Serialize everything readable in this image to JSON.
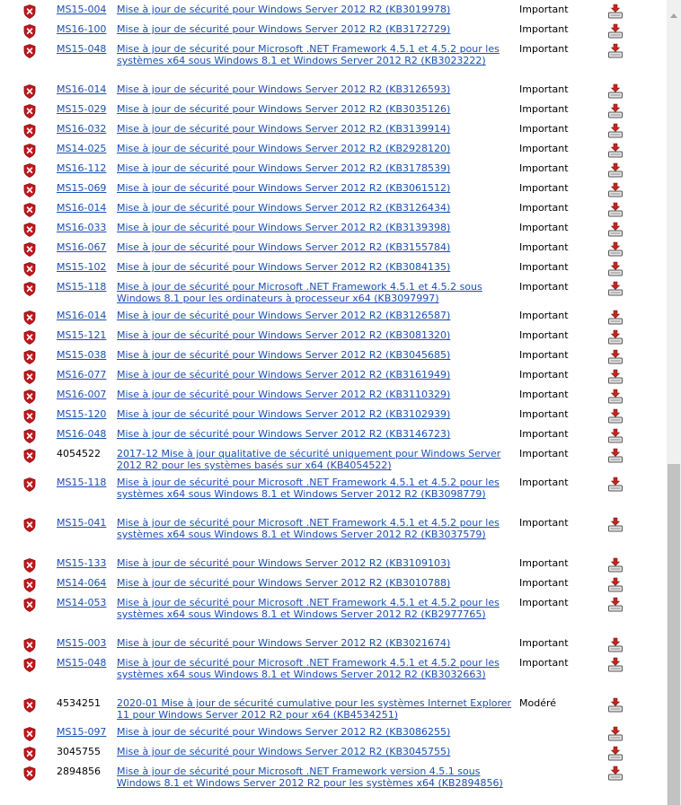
{
  "rows": [
    {
      "bulletin": "MS15-004",
      "is_link": true,
      "title": "Mise à jour de sécurité pour Windows Server 2012 R2 (KB3019978)",
      "severity": "Important"
    },
    {
      "bulletin": "MS16-100",
      "is_link": true,
      "title": "Mise à jour de sécurité pour Windows Server 2012 R2 (KB3172729)",
      "severity": "Important"
    },
    {
      "bulletin": "MS15-048",
      "is_link": true,
      "title": "Mise à jour de sécurité pour Microsoft .NET Framework 4.5.1 et 4.5.2 pour les systèmes x64 sous Windows 8.1 et Windows Server 2012 R2 (KB3023222)",
      "severity": "Important"
    },
    {
      "bulletin": "MS16-014",
      "is_link": true,
      "title": "Mise à jour de sécurité pour Windows Server 2012 R2 (KB3126593)",
      "severity": "Important"
    },
    {
      "bulletin": "MS15-029",
      "is_link": true,
      "title": "Mise à jour de sécurité pour Windows Server 2012 R2 (KB3035126)",
      "severity": "Important"
    },
    {
      "bulletin": "MS16-032",
      "is_link": true,
      "title": "Mise à jour de sécurité pour Windows Server 2012 R2 (KB3139914)",
      "severity": "Important"
    },
    {
      "bulletin": "MS14-025",
      "is_link": true,
      "title": "Mise à jour de sécurité pour Windows Server 2012 R2 (KB2928120)",
      "severity": "Important"
    },
    {
      "bulletin": "MS16-112",
      "is_link": true,
      "title": "Mise à jour de sécurité pour Windows Server 2012 R2 (KB3178539)",
      "severity": "Important"
    },
    {
      "bulletin": "MS15-069",
      "is_link": true,
      "title": "Mise à jour de sécurité pour Windows Server 2012 R2 (KB3061512)",
      "severity": "Important"
    },
    {
      "bulletin": "MS16-014",
      "is_link": true,
      "title": "Mise à jour de sécurité pour Windows Server 2012 R2 (KB3126434)",
      "severity": "Important"
    },
    {
      "bulletin": "MS16-033",
      "is_link": true,
      "title": "Mise à jour de sécurité pour Windows Server 2012 R2 (KB3139398)",
      "severity": "Important"
    },
    {
      "bulletin": "MS16-067",
      "is_link": true,
      "title": "Mise à jour de sécurité pour Windows Server 2012 R2 (KB3155784)",
      "severity": "Important"
    },
    {
      "bulletin": "MS15-102",
      "is_link": true,
      "title": "Mise à jour de sécurité pour Windows Server 2012 R2 (KB3084135)",
      "severity": "Important"
    },
    {
      "bulletin": "MS15-118",
      "is_link": true,
      "title": "Mise à jour de sécurité pour Microsoft .NET Framework 4.5.1 et 4.5.2 sous Windows 8.1 pour les ordinateurs à processeur x64 (KB3097997)",
      "severity": "Important"
    },
    {
      "bulletin": "MS16-014",
      "is_link": true,
      "title": "Mise à jour de sécurité pour Windows Server 2012 R2 (KB3126587)",
      "severity": "Important"
    },
    {
      "bulletin": "MS15-121",
      "is_link": true,
      "title": "Mise à jour de sécurité pour Windows Server 2012 R2 (KB3081320)",
      "severity": "Important"
    },
    {
      "bulletin": "MS15-038",
      "is_link": true,
      "title": "Mise à jour de sécurité pour Windows Server 2012 R2 (KB3045685)",
      "severity": "Important"
    },
    {
      "bulletin": "MS16-077",
      "is_link": true,
      "title": "Mise à jour de sécurité pour Windows Server 2012 R2 (KB3161949)",
      "severity": "Important"
    },
    {
      "bulletin": "MS16-007",
      "is_link": true,
      "title": "Mise à jour de sécurité pour Windows Server 2012 R2 (KB3110329)",
      "severity": "Important"
    },
    {
      "bulletin": "MS15-120",
      "is_link": true,
      "title": "Mise à jour de sécurité pour Windows Server 2012 R2 (KB3102939)",
      "severity": "Important"
    },
    {
      "bulletin": "MS16-048",
      "is_link": true,
      "title": "Mise à jour de sécurité pour Windows Server 2012 R2 (KB3146723)",
      "severity": "Important"
    },
    {
      "bulletin": "4054522",
      "is_link": false,
      "title": "2017-12 Mise à jour qualitative de sécurité uniquement pour Windows Server 2012 R2 pour les systèmes basés sur x64 (KB4054522)",
      "severity": "Important"
    },
    {
      "bulletin": "MS15-118",
      "is_link": true,
      "title": "Mise à jour de sécurité pour Microsoft .NET Framework 4.5.1 et 4.5.2 pour les systèmes x64 sous Windows 8.1 et Windows Server 2012 R2 (KB3098779)",
      "severity": "Important"
    },
    {
      "bulletin": "MS15-041",
      "is_link": true,
      "title": "Mise à jour de sécurité pour Microsoft .NET Framework 4.5.1 et 4.5.2 pour les systèmes x64 sous Windows 8.1 et Windows Server 2012 R2 (KB3037579)",
      "severity": "Important"
    },
    {
      "bulletin": "MS15-133",
      "is_link": true,
      "title": "Mise à jour de sécurité pour Windows Server 2012 R2 (KB3109103)",
      "severity": "Important"
    },
    {
      "bulletin": "MS14-064",
      "is_link": true,
      "title": "Mise à jour de sécurité pour Windows Server 2012 R2 (KB3010788)",
      "severity": "Important"
    },
    {
      "bulletin": "MS14-053",
      "is_link": true,
      "title": "Mise à jour de sécurité pour Microsoft .NET Framework 4.5.1 et 4.5.2 pour les systèmes x64 sous Windows 8.1 et Windows Server 2012 R2 (KB2977765)",
      "severity": "Important"
    },
    {
      "bulletin": "MS15-003",
      "is_link": true,
      "title": "Mise à jour de sécurité pour Windows Server 2012 R2 (KB3021674)",
      "severity": "Important"
    },
    {
      "bulletin": "MS15-048",
      "is_link": true,
      "title": "Mise à jour de sécurité pour Microsoft .NET Framework 4.5.1 et 4.5.2 pour les systèmes x64 sous Windows 8.1 et Windows Server 2012 R2 (KB3032663)",
      "severity": "Important"
    },
    {
      "bulletin": "4534251",
      "is_link": false,
      "title": "2020-01 Mise à jour de sécurité cumulative pour les systèmes Internet Explorer 11 pour Windows Server 2012 R2 pour x64 (KB4534251)",
      "severity": "Modéré"
    },
    {
      "bulletin": "MS15-097",
      "is_link": true,
      "title": "Mise à jour de sécurité pour Windows Server 2012 R2 (KB3086255)",
      "severity": ""
    },
    {
      "bulletin": "3045755",
      "is_link": false,
      "title": "Mise à jour de sécurité pour Windows Server 2012 R2 (KB3045755)",
      "severity": ""
    },
    {
      "bulletin": "2894856",
      "is_link": false,
      "title": "Mise à jour de sécurité pour Microsoft .NET Framework version 4.5.1 sous Windows 8.1 et Windows Server 2012 R2 pour les systèmes x64 (KB2894856)",
      "severity": ""
    }
  ],
  "icons": {
    "severity": "shield-error-icon",
    "download": "download-icon"
  },
  "colors": {
    "link": "#1a4fb0",
    "shield": "#c0171e",
    "download_arrow": "#c8241d"
  }
}
